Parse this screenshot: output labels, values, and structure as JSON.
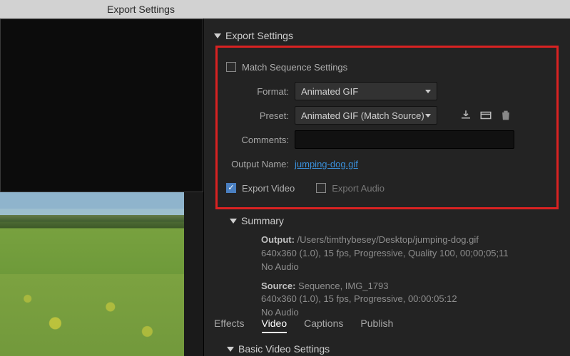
{
  "window": {
    "title": "Export Settings"
  },
  "export_settings": {
    "header": "Export Settings",
    "match_sequence": {
      "label": "Match Sequence Settings",
      "checked": false
    },
    "format": {
      "label": "Format:",
      "value": "Animated GIF"
    },
    "preset": {
      "label": "Preset:",
      "value": "Animated GIF (Match Source)"
    },
    "comments": {
      "label": "Comments:",
      "value": ""
    },
    "output_name": {
      "label": "Output Name:",
      "value": "jumping-dog.gif"
    },
    "export_video": {
      "label": "Export Video",
      "checked": true
    },
    "export_audio": {
      "label": "Export Audio",
      "checked": false
    }
  },
  "summary": {
    "header": "Summary",
    "output_label": "Output:",
    "output_lines": [
      "/Users/timthybesey/Desktop/jumping-dog.gif",
      "640x360 (1.0), 15 fps, Progressive, Quality 100, 00;00;05;11",
      "No Audio"
    ],
    "source_label": "Source:",
    "source_lines": [
      "Sequence, IMG_1793",
      "640x360 (1.0), 15 fps, Progressive, 00:00:05:12",
      "No Audio"
    ]
  },
  "tabs": {
    "effects": "Effects",
    "video": "Video",
    "captions": "Captions",
    "publish": "Publish",
    "active": "video"
  },
  "basic_video": {
    "header": "Basic Video Settings"
  }
}
